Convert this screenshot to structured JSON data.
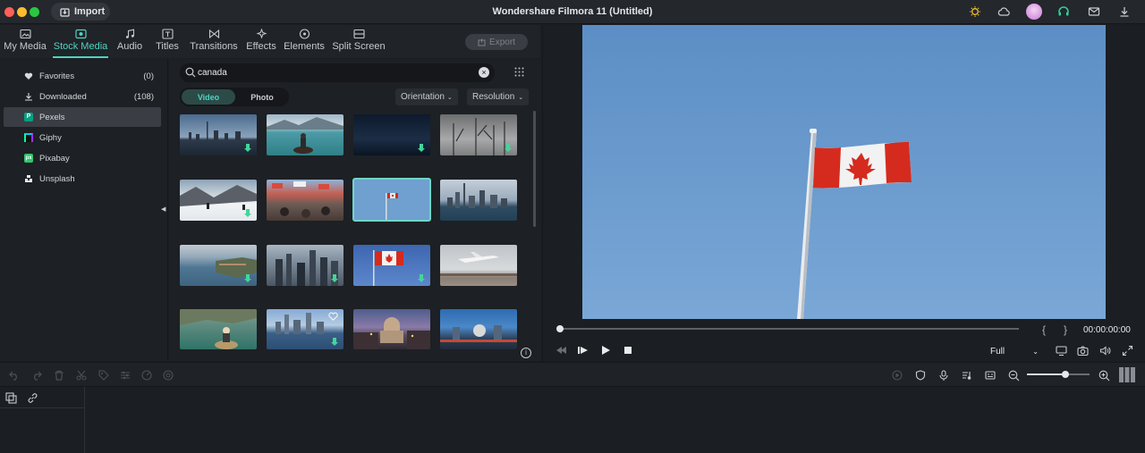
{
  "app": {
    "title": "Wondershare Filmora 11 (Untitled)",
    "import_label": "Import",
    "export_label": "Export",
    "accent": "#4ed3c0"
  },
  "tabs": [
    {
      "label": "My Media",
      "icon": "media-icon"
    },
    {
      "label": "Stock Media",
      "icon": "stock-media-icon",
      "active": true
    },
    {
      "label": "Audio",
      "icon": "music-note-icon"
    },
    {
      "label": "Titles",
      "icon": "titles-icon"
    },
    {
      "label": "Transitions",
      "icon": "transitions-icon"
    },
    {
      "label": "Effects",
      "icon": "sparkle-icon"
    },
    {
      "label": "Elements",
      "icon": "elements-icon"
    },
    {
      "label": "Split Screen",
      "icon": "split-screen-icon"
    }
  ],
  "sidebar": {
    "items": [
      {
        "label": "Favorites",
        "count": "(0)",
        "icon": "heart-icon"
      },
      {
        "label": "Downloaded",
        "count": "(108)",
        "icon": "download-icon"
      },
      {
        "label": "Pexels",
        "count": "",
        "icon": "pexels-logo-icon",
        "selected": true
      },
      {
        "label": "Giphy",
        "count": "",
        "icon": "giphy-logo-icon"
      },
      {
        "label": "Pixabay",
        "count": "",
        "icon": "pixabay-logo-icon"
      },
      {
        "label": "Unsplash",
        "count": "",
        "icon": "unsplash-logo-icon"
      }
    ]
  },
  "search": {
    "value": "canada"
  },
  "filters": {
    "video_label": "Video",
    "photo_label": "Photo",
    "orientation_label": "Orientation",
    "resolution_label": "Resolution"
  },
  "thumbnails": [
    {
      "subject": "city skyline at dusk",
      "downloaded": true
    },
    {
      "subject": "canoe on lake",
      "downloaded": false
    },
    {
      "subject": "night sky",
      "downloaded": true
    },
    {
      "subject": "bare trees",
      "downloaded": true
    },
    {
      "subject": "snowy slope",
      "downloaded": true
    },
    {
      "subject": "street market crowd",
      "downloaded": false
    },
    {
      "subject": "flag on pole",
      "downloaded": false,
      "selected": true
    },
    {
      "subject": "city waterfront",
      "downloaded": false
    },
    {
      "subject": "coastal town aerial",
      "downloaded": true
    },
    {
      "subject": "city aerial",
      "downloaded": true
    },
    {
      "subject": "canadian flag",
      "downloaded": true
    },
    {
      "subject": "airplane landing",
      "downloaded": false
    },
    {
      "subject": "kayak river",
      "downloaded": false
    },
    {
      "subject": "harbour skyline",
      "downloaded": true,
      "favorite": true
    },
    {
      "subject": "domed building at dusk",
      "downloaded": false
    },
    {
      "subject": "city at night",
      "downloaded": false
    }
  ],
  "player": {
    "timecode": "00:00:00:00",
    "quality": "Full",
    "mark_in": "{",
    "mark_out": "}"
  }
}
